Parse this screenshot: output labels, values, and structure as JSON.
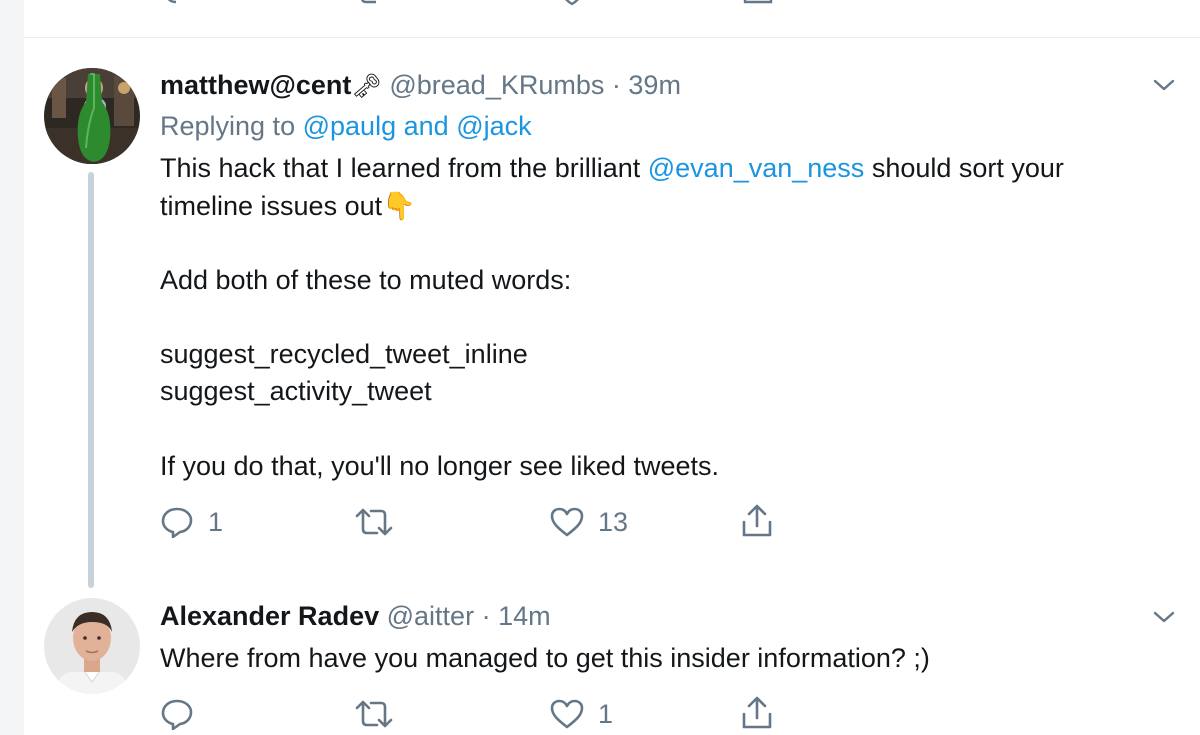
{
  "tweet1": {
    "author_name": "matthew@cent",
    "author_emoji": "🗝",
    "handle": "@bread_KRumbs",
    "separator": "·",
    "time": "39m",
    "replying_prefix": "Replying to",
    "replying_to_1": "@paulg",
    "replying_and": "and",
    "replying_to_2": "@jack",
    "body_line1_pre": "This hack that I learned from the brilliant",
    "body_mention": "@evan_van_ness",
    "body_line1_post": "should sort your",
    "body_line2": "timeline issues out",
    "body_line2_emoji": "👇",
    "body_line3": "Add both of these to muted words:",
    "body_line4": "suggest_recycled_tweet_inline",
    "body_line5": "suggest_activity_tweet",
    "body_line6": "If you do that, you'll no longer see liked tweets.",
    "actions": {
      "replies": "1",
      "retweets": "",
      "likes": "13"
    }
  },
  "tweet2": {
    "author_name": "Alexander Radev",
    "handle": "@aitter",
    "separator": "·",
    "time": "14m",
    "body": "Where from have you managed to get this insider information? ;)",
    "actions": {
      "replies": "",
      "retweets": "",
      "likes": "1"
    }
  },
  "icons": {
    "reply": "reply-icon",
    "retweet": "retweet-icon",
    "like": "heart-icon",
    "share": "share-icon",
    "more": "chevron-down-icon"
  },
  "colors": {
    "link": "#1b95e0",
    "secondary_text": "#657786",
    "thread_line": "#c6d1d9",
    "divider": "#e6ecf0"
  }
}
